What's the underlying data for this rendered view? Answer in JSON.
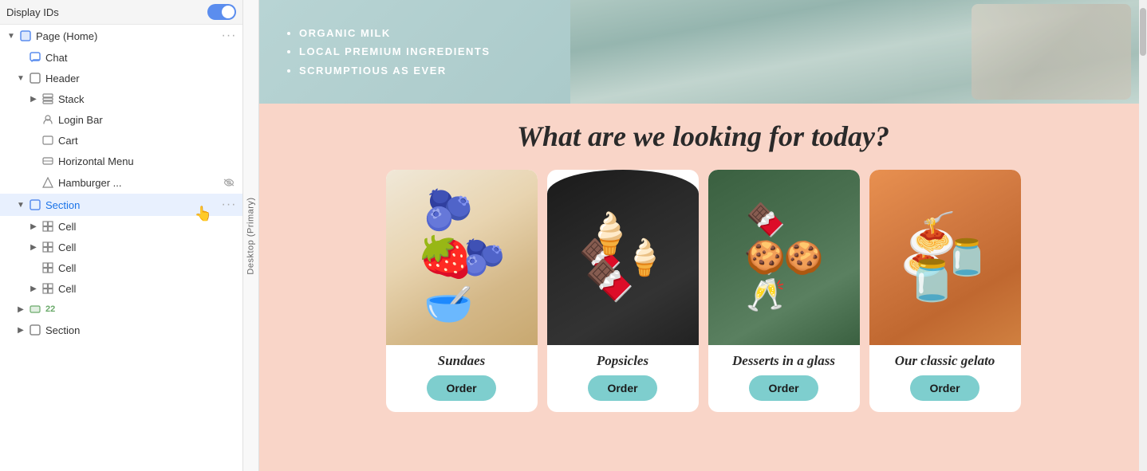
{
  "panel": {
    "header": {
      "label": "Display IDs"
    },
    "items": [
      {
        "id": "page-home",
        "label": "Page (Home)",
        "indent": 0,
        "type": "page",
        "chevron": "open",
        "selected": false,
        "actions": [
          "more"
        ]
      },
      {
        "id": "chat",
        "label": "Chat",
        "indent": 1,
        "type": "chat",
        "chevron": "empty",
        "selected": false,
        "actions": []
      },
      {
        "id": "header",
        "label": "Header",
        "indent": 1,
        "type": "section",
        "chevron": "open",
        "selected": false,
        "actions": []
      },
      {
        "id": "stack",
        "label": "Stack",
        "indent": 2,
        "type": "stack",
        "chevron": "closed",
        "selected": false,
        "actions": []
      },
      {
        "id": "login-bar",
        "label": "Login Bar",
        "indent": 2,
        "type": "loginbar",
        "chevron": "empty",
        "selected": false,
        "actions": []
      },
      {
        "id": "cart",
        "label": "Cart",
        "indent": 2,
        "type": "cart",
        "chevron": "empty",
        "selected": false,
        "actions": []
      },
      {
        "id": "horizontal-menu",
        "label": "Horizontal Menu",
        "indent": 2,
        "type": "menu",
        "chevron": "empty",
        "selected": false,
        "actions": []
      },
      {
        "id": "hamburger",
        "label": "Hamburger ...",
        "indent": 2,
        "type": "hamburger",
        "chevron": "empty",
        "selected": false,
        "actions": [
          "eye"
        ]
      },
      {
        "id": "section-1",
        "label": "Section",
        "indent": 1,
        "type": "section",
        "chevron": "open",
        "selected": true,
        "actions": [
          "more"
        ]
      },
      {
        "id": "cell-1",
        "label": "Cell",
        "indent": 2,
        "type": "cell",
        "chevron": "closed",
        "selected": false,
        "actions": []
      },
      {
        "id": "cell-2",
        "label": "Cell",
        "indent": 2,
        "type": "cell",
        "chevron": "closed",
        "selected": false,
        "actions": []
      },
      {
        "id": "cell-3",
        "label": "Cell",
        "indent": 2,
        "type": "cell",
        "chevron": "empty",
        "selected": false,
        "actions": []
      },
      {
        "id": "cell-4",
        "label": "Cell",
        "indent": 2,
        "type": "cell",
        "chevron": "closed",
        "selected": false,
        "actions": []
      },
      {
        "id": "num-22",
        "label": "22",
        "indent": 1,
        "type": "num",
        "chevron": "closed",
        "selected": false,
        "actions": []
      },
      {
        "id": "section-2",
        "label": "Section",
        "indent": 1,
        "type": "section",
        "chevron": "closed",
        "selected": false,
        "actions": []
      }
    ]
  },
  "viewport": {
    "label": "Desktop (Primary)"
  },
  "canvas": {
    "hero": {
      "bullets": [
        "Organic Milk",
        "Local Premium Ingredients",
        "Scrumptious as Ever"
      ]
    },
    "pink_section": {
      "title": "What are we looking for today?",
      "cards": [
        {
          "id": "sundaes",
          "name": "Sundaes",
          "order_label": "Order"
        },
        {
          "id": "popsicles",
          "name": "Popsicles",
          "order_label": "Order"
        },
        {
          "id": "desserts",
          "name": "Desserts in a glass",
          "order_label": "Order"
        },
        {
          "id": "gelato",
          "name": "Our classic gelato",
          "order_label": "Order"
        }
      ]
    }
  }
}
